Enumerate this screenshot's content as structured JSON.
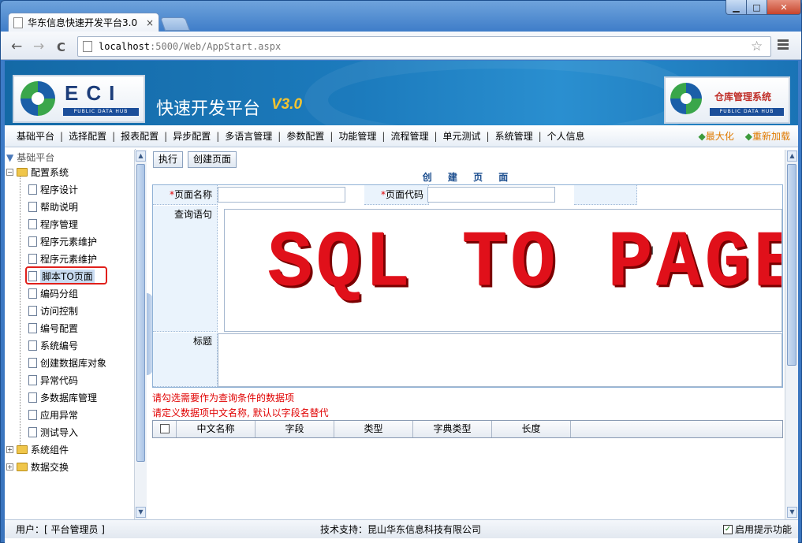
{
  "browser": {
    "tab_title": "华东信息快速开发平台3.0",
    "tab_close": "×",
    "url_host": "localhost",
    "url_rest": ":5000/Web/AppStart.aspx",
    "back": "←",
    "forward": "→",
    "reload": "C",
    "star": "☆"
  },
  "window": {
    "minimize": "▁",
    "maximize": "□",
    "close": "✕"
  },
  "banner": {
    "logo_text": "ECI",
    "logo_bar": "PUBLIC DATA HUB",
    "title": "快速开发平台",
    "version": "V3.0",
    "right_logo_text": "仓库管理系统",
    "right_logo_bar": "PUBLIC DATA HUB"
  },
  "nav": {
    "items": [
      "基础平台",
      "选择配置",
      "报表配置",
      "异步配置",
      "多语言管理",
      "参数配置",
      "功能管理",
      "流程管理",
      "单元测试",
      "系统管理",
      "个人信息"
    ],
    "separator": "|",
    "maximize": "最大化",
    "reload": "重新加载",
    "bullet": "◆"
  },
  "tree": {
    "root": "基础平台",
    "group1": "配置系统",
    "children": [
      "程序设计",
      "帮助说明",
      "程序管理",
      "程序元素维护",
      "程序元素维护",
      "脚本TO页面",
      "编码分组",
      "访问控制",
      "编号配置",
      "系统编号",
      "创建数据库对象",
      "异常代码",
      "多数据库管理",
      "应用异常",
      "测试导入"
    ],
    "group2": "系统组件",
    "group3": "数据交换",
    "expand": "+",
    "collapse": "−"
  },
  "toolbar": {
    "execute": "执行",
    "create_page": "创建页面"
  },
  "form": {
    "title": "创 建 页 面",
    "required_mark": "*",
    "page_name_label": "页面名称",
    "page_code_label": "页面代码",
    "query_label": "查询语句",
    "title_label": "标题",
    "sql_text": "SQL TO PAGE"
  },
  "hints": {
    "line1": "请勾选需要作为查询条件的数据项",
    "line2": "请定义数据项中文名称, 默认以字段名替代"
  },
  "grid": {
    "columns": [
      "中文名称",
      "字段",
      "类型",
      "字典类型",
      "长度"
    ]
  },
  "status": {
    "user": "用户：[ 平台管理员 ]",
    "support": "技术支持：昆山华东信息科技有限公司",
    "hint_toggle": "启用提示功能",
    "checked": "✓"
  },
  "colors": {
    "accent": "#1c7bbd",
    "required": "#e00000",
    "highlight_box": "#e0201b",
    "nav_action": "#e07a00"
  }
}
